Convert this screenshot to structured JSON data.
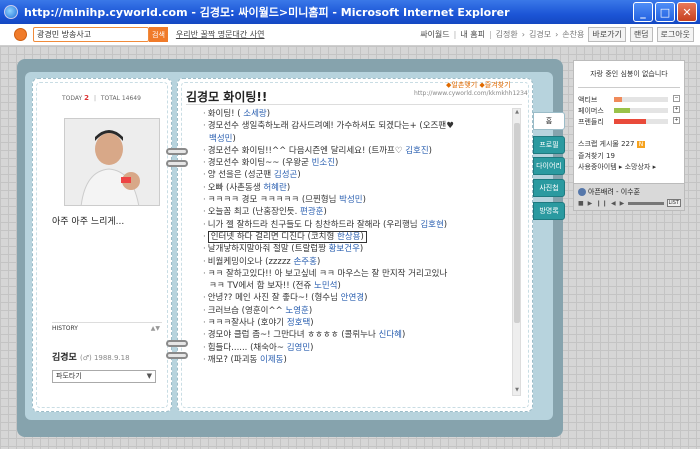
{
  "window": {
    "title": "http://minihp.cyworld.com - 김경모: 싸이월드>미니홈피 - Microsoft Internet Explorer",
    "min": "_",
    "max": "□",
    "close": "✕"
  },
  "toolbar": {
    "search_value": "광경민 방송사고",
    "search_button": "검색",
    "link": "우리반 꿀짝 명문대간 사연",
    "cyworld": "싸이월드",
    "myhome": "내 홈피",
    "crumbs": [
      "김정환",
      "김경모",
      "손찬용"
    ],
    "shortcut": "바로가기",
    "random": "랜덤",
    "logout": "로그아웃"
  },
  "left": {
    "today_label": "TODAY",
    "today_value": "2",
    "total_label": "TOTAL",
    "total_value": "14649",
    "status": "아주 아주 느리게...",
    "history": "HISTORY",
    "history_arrows": "▲▼",
    "owner_name": "김경모",
    "owner_info": "(♂) 1988.9.18",
    "dropdown": "파도타기",
    "dropdown_arrow": "▼"
  },
  "right": {
    "title": "김경모 화이팅!!",
    "links": "◆일촌맺기 ◆즐겨찾기",
    "url": "http://www.cyworld.com/kkmkhh1234",
    "entries": [
      {
        "text": "화이팅! (",
        "name": "소세랑",
        "tail": ")"
      },
      {
        "text": "경모선수 생일축하노래 감사드려예! 가수하셔도 되겠다는+ (오즈팬♥",
        "name": "",
        "tail": ""
      },
      {
        "text": "",
        "name": "백성민",
        "tail": ")",
        "indent": true
      },
      {
        "text": "경모선수 화이팅!!^^ 다음시즌엔 달리세요! (트까프♡",
        "name": "김호진",
        "tail": ")"
      },
      {
        "text": "경모선수 화이팅~~ (우왕굳",
        "name": "빈소진",
        "tail": ")"
      },
      {
        "text": "양 선을은 (성군팬",
        "name": "김성곤",
        "tail": ")"
      },
      {
        "text": "오빠 (사촌동생",
        "name": "허혜란",
        "tail": ")"
      },
      {
        "text": "ㅋㅋㅋㅋ 경모 ㅋㅋㅋㅋㅋ (므찐형님",
        "name": "박성민",
        "tail": ")"
      },
      {
        "text": "오늘꼼 최고 (난홈장인듯.",
        "name": "편광훈",
        "tail": ")"
      },
      {
        "text": "니가 젤 잘하드라 친구들도 다 칭찬하드라 잘해라 (우리행님",
        "name": "김호현",
        "tail": ")"
      },
      {
        "text": "인터넷 하다 걸리면 디진다 (코치형",
        "name": "한상용",
        "tail": ")",
        "boxed": true
      },
      {
        "text": "날개낳하지말아줘 절말 (트랄럽짱",
        "name": "황보건우",
        "tail": ")"
      },
      {
        "text": "비월케밍이오나 (zzzzz",
        "name": "손주홍",
        "tail": ")"
      },
      {
        "text": "ㅋㅋ 잘하고있다!! 아 보고싶네 ㅋㅋ 마우스는 잘 만지작 거리고있나",
        "name": "",
        "tail": ""
      },
      {
        "text": "ㅋㅋ TV에서 함 보자!! (전쥬",
        "name": "노민석",
        "tail": ")",
        "indent": true
      },
      {
        "text": "안녕?? 메인 사진 잘 좋다~! (형수님",
        "name": "안연경",
        "tail": ")"
      },
      {
        "text": "크러브습 (영훈이^^",
        "name": "노영훈",
        "tail": ")"
      },
      {
        "text": "ㅋㅋㅋ잘사나 (호야기",
        "name": "정호택",
        "tail": ")"
      },
      {
        "text": "경모야 클럽 좀~! 그만다녀 ㅎㅎㅎㅎ (콜뤼누나",
        "name": "신다혜",
        "tail": ")"
      },
      {
        "text": "힘들다...... (채숙아~",
        "name": "김영민",
        "tail": ")"
      },
      {
        "text": "깨모? (파괴동",
        "name": "이제동",
        "tail": ")"
      }
    ]
  },
  "tabs": [
    "홈",
    "프로필",
    "다이어리",
    "사진첩",
    "방명록"
  ],
  "side": {
    "bored": "자랑 중인 심봉이 없습니다",
    "stats": [
      {
        "label": "액티브",
        "value": 0.15,
        "color": "#f08a5a"
      },
      {
        "label": "페이머스",
        "value": 0.3,
        "color": "#9ac24a"
      },
      {
        "label": "프렌들리",
        "value": 0.6,
        "color": "#e94a3a"
      }
    ],
    "scrap": "스크랩 게시물 227",
    "scrap_badge": "N",
    "fav": "즐겨찾기 19",
    "fav_people": "사용중아이템 ▸ 소망상자 ▸",
    "music_song": "아픈배려 - 이수훈",
    "music_ctrl": "■ ▶ ❙❙ ◀ ▶",
    "music_list": "LIST"
  }
}
